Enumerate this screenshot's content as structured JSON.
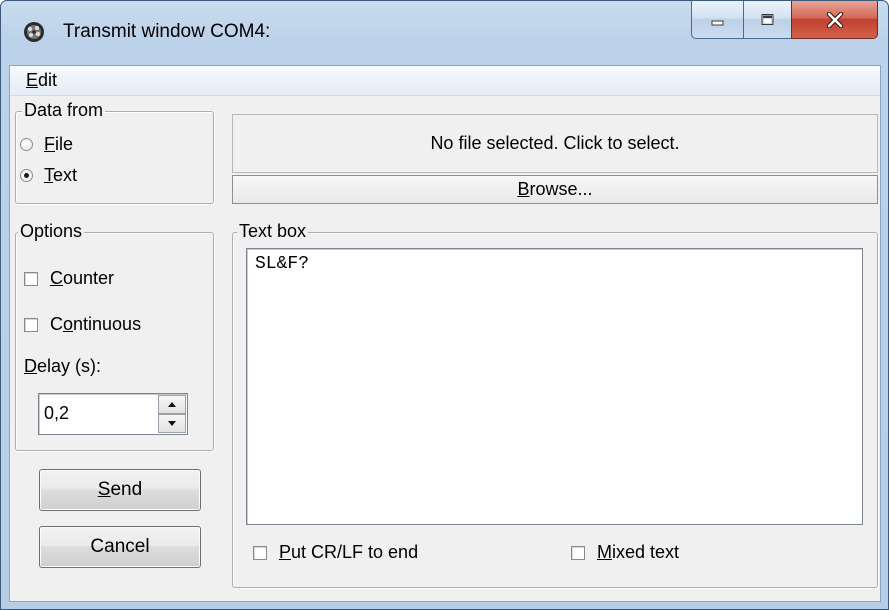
{
  "window": {
    "title": "Transmit window COM4:"
  },
  "menu": {
    "edit_prefix": "E",
    "edit_rest": "dit"
  },
  "data_from": {
    "label": "Data from",
    "file_prefix": "F",
    "file_rest": "ile",
    "text_prefix": "T",
    "text_rest": "ext",
    "selected": "Text"
  },
  "file_panel": {
    "status": "No file selected. Click to select."
  },
  "browse": {
    "prefix": "B",
    "rest": "rowse..."
  },
  "options": {
    "label": "Options",
    "counter_prefix": "C",
    "counter_rest": "ounter",
    "continuous_a": "C",
    "continuous_u": "o",
    "continuous_rest": "ntinuous",
    "delay_prefix": "D",
    "delay_rest": "elay (s):",
    "delay_value": "0,2"
  },
  "textbox": {
    "label": "Text box",
    "content": "SL&F?"
  },
  "bottom": {
    "crlf_prefix": "P",
    "crlf_rest": "ut CR/LF to end",
    "mixed_prefix": "M",
    "mixed_rest": "ixed text"
  },
  "buttons": {
    "send_prefix": "S",
    "send_rest": "end",
    "cancel": "Cancel"
  },
  "icons": [
    "app-icon",
    "minimize-icon",
    "maximize-icon",
    "close-icon",
    "spin-up-icon",
    "spin-down-icon"
  ],
  "colors": {
    "close_button": "#c0412f",
    "title_bar": "#c9dcef",
    "client_bg": "#f0f0f0"
  }
}
